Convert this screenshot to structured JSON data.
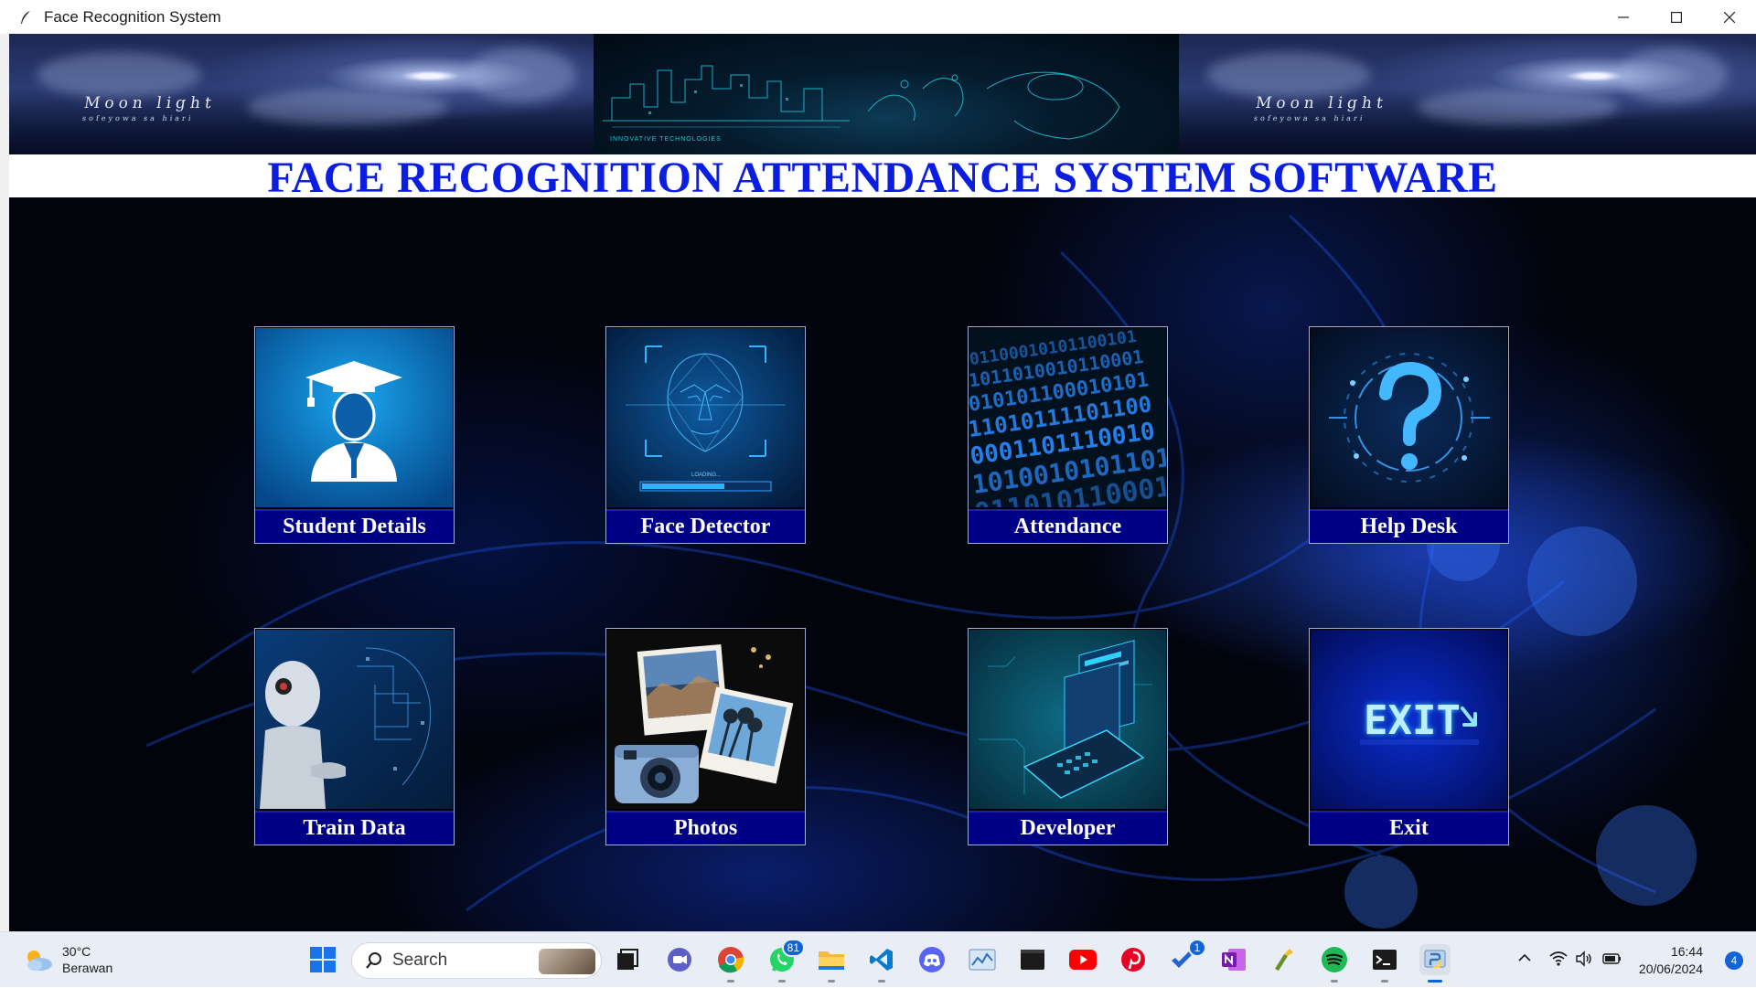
{
  "window": {
    "title": "Face Recognition System",
    "controls": [
      "minimize-icon",
      "maximize-icon",
      "close-icon"
    ]
  },
  "banner": {
    "left_text": "Moon light",
    "left_subtext": "sofeyowa sa hiari",
    "right_text": "Moon light",
    "right_subtext": "sofeyowa sa hiari",
    "center_text": "INNOVATIVE TECHNOLOGIES"
  },
  "heading": "FACE RECOGNITION ATTENDANCE SYSTEM SOFTWARE",
  "tiles": [
    {
      "label": "Student Details",
      "icon": "student-icon"
    },
    {
      "label": "Face Detector",
      "icon": "face-scan-icon"
    },
    {
      "label": "Attendance",
      "icon": "binary-data-icon"
    },
    {
      "label": "Help Desk",
      "icon": "question-mark-icon"
    },
    {
      "label": "Train Data",
      "icon": "ai-robot-icon"
    },
    {
      "label": "Photos",
      "icon": "photos-camera-icon"
    },
    {
      "label": "Developer",
      "icon": "laptop-code-icon"
    },
    {
      "label": "Exit",
      "icon": "exit-sign-icon"
    }
  ],
  "taskbar": {
    "weather": {
      "temp": "30°C",
      "condition": "Berawan"
    },
    "search_placeholder": "Search",
    "badges": {
      "whatsapp": "81",
      "todo": "1"
    },
    "clock": {
      "time": "16:44",
      "date": "20/06/2024"
    },
    "notifications": "4",
    "accent": "#0a64d8"
  },
  "colors": {
    "heading": "#0b1de0",
    "tile_label_bg": "#000087",
    "stage_bg": "#02040c"
  }
}
